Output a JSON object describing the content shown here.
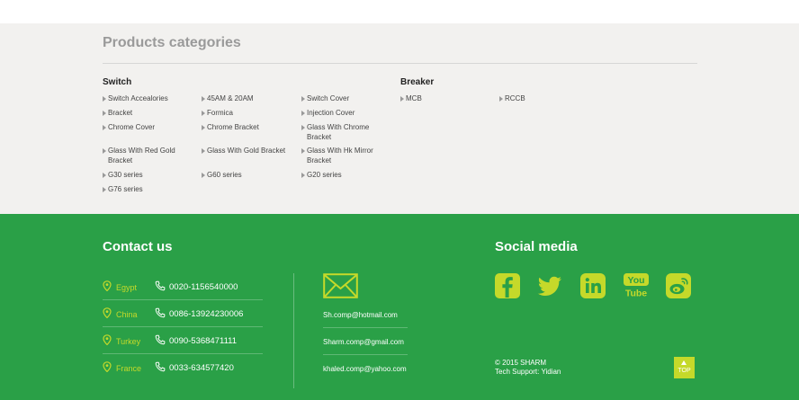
{
  "products": {
    "title": "Products categories",
    "switch_label": "Switch",
    "breaker_label": "Breaker",
    "switch_col1": [
      "Switch Accealories",
      "Bracket",
      "Chrome Cover",
      "Glass With Red Gold Bracket",
      "G30 series",
      "G76 series"
    ],
    "switch_col2": [
      "45AM & 20AM",
      "Formica",
      "Chrome Bracket",
      "Glass With Gold Bracket",
      "G60 series"
    ],
    "switch_col3": [
      "Switch Cover",
      "Injection Cover",
      "Glass With Chrome Bracket",
      "Glass With Hk Mirror Bracket",
      "G20 series"
    ],
    "breaker_items": [
      "MCB",
      "RCCB"
    ]
  },
  "contact": {
    "title": "Contact us",
    "rows": [
      {
        "country": "Egypt",
        "phone": "0020-1156540000"
      },
      {
        "country": "China",
        "phone": "0086-13924230006"
      },
      {
        "country": "Turkey",
        "phone": "0090-5368471111"
      },
      {
        "country": "France",
        "phone": "0033-634577420"
      }
    ],
    "emails": [
      "Sh.comp@hotmail.com",
      "Sharm.comp@gmail.com",
      "khaled.comp@yahoo.com"
    ]
  },
  "social": {
    "title": "Social media",
    "icons": [
      "facebook-icon",
      "twitter-icon",
      "linkedin-icon",
      "youtube-icon",
      "weibo-icon"
    ],
    "youtube_text_top": "You",
    "youtube_text_bottom": "Tube"
  },
  "footer": {
    "copyright": "© 2015 SHARM",
    "tech_support": "Tech Support: Yidian",
    "top_label": "TOP"
  },
  "colors": {
    "footer_green": "#2aa047",
    "accent_lime": "#c5d92a",
    "products_bg": "#f2f1ef"
  }
}
